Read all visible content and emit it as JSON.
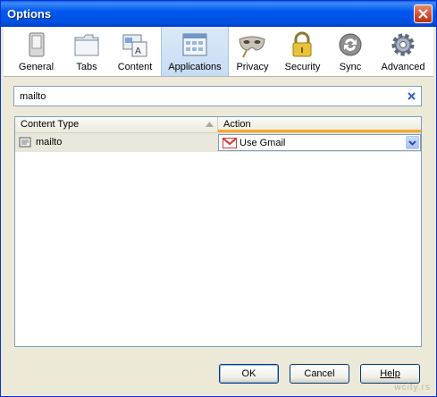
{
  "window": {
    "title": "Options"
  },
  "toolbar": {
    "items": [
      {
        "label": "General",
        "icon": "general-icon"
      },
      {
        "label": "Tabs",
        "icon": "tabs-icon"
      },
      {
        "label": "Content",
        "icon": "content-icon"
      },
      {
        "label": "Applications",
        "icon": "applications-icon",
        "selected": true
      },
      {
        "label": "Privacy",
        "icon": "privacy-mask-icon"
      },
      {
        "label": "Security",
        "icon": "security-lock-icon"
      },
      {
        "label": "Sync",
        "icon": "sync-icon"
      },
      {
        "label": "Advanced",
        "icon": "advanced-gear-icon"
      }
    ]
  },
  "search": {
    "value": "mailto"
  },
  "table": {
    "headers": {
      "content_type": "Content Type",
      "action": "Action"
    },
    "rows": [
      {
        "content_type": "mailto",
        "action": "Use Gmail"
      }
    ]
  },
  "buttons": {
    "ok": "OK",
    "cancel": "Cancel",
    "help": "Help"
  },
  "watermark": "wcity.rs",
  "colors": {
    "titlebar": "#0054e3",
    "selected_tab": "#c6dcf4",
    "sort_accent": "#f7a830"
  }
}
